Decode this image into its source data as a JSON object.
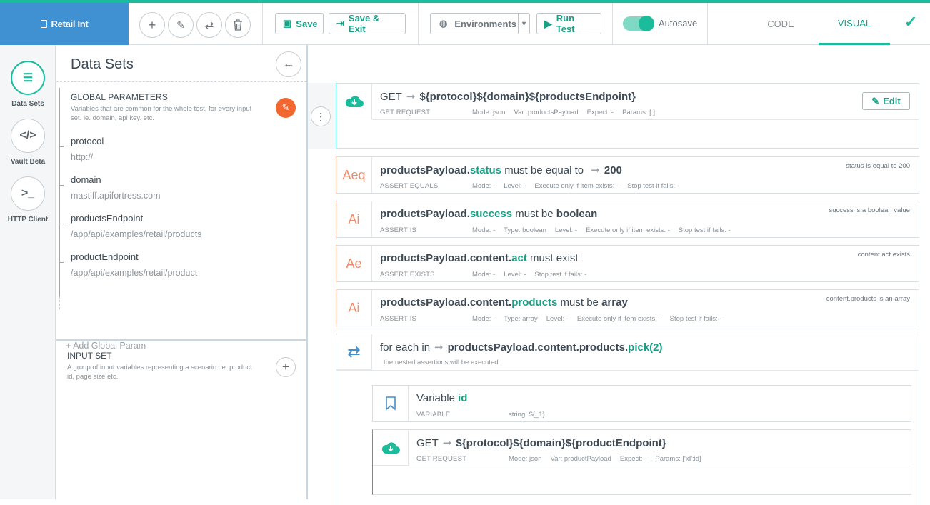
{
  "header": {
    "brand": "Retail Int",
    "save": "Save",
    "save_exit": "Save & Exit",
    "environments": "Environments",
    "run_test": "Run Test",
    "autosave": "Autosave",
    "tab_code": "CODE",
    "tab_visual": "VISUAL"
  },
  "leftnav": {
    "items": [
      {
        "label": "Data Sets",
        "icon": "list-icon"
      },
      {
        "label": "Vault Beta",
        "icon": "code-icon"
      },
      {
        "label": "HTTP Client",
        "icon": "terminal-icon"
      }
    ]
  },
  "panel": {
    "title": "Data Sets",
    "global_title": "GLOBAL PARAMETERS",
    "global_desc": "Variables that are common for the whole test, for every input set. ie. domain, api key. etc.",
    "params": [
      {
        "name": "protocol",
        "value": "http://"
      },
      {
        "name": "domain",
        "value": "mastiff.apifortress.com"
      },
      {
        "name": "productsEndpoint",
        "value": "/app/api/examples/retail/products"
      },
      {
        "name": "productEndpoint",
        "value": "/app/api/examples/retail/product"
      }
    ],
    "add_global": "+ Add Global Param",
    "input_title": "INPUT SET",
    "input_desc": "A group of input variables representing a scenario. ie. product id, page size etc."
  },
  "canvas": {
    "get1": {
      "method": "GET",
      "url": "${protocol}${domain}${productsEndpoint}",
      "label": "GET REQUEST",
      "mode": "Mode: json",
      "var": "Var: productsPayload",
      "expect": "Expect: -",
      "params": "Params: [:]",
      "edit": "Edit"
    },
    "assert1": {
      "icon": "Aeq",
      "obj": "productsPayload.",
      "field": "status",
      "text": " must be equal to ",
      "value": "200",
      "label": "ASSERT EQUALS",
      "meta": [
        "Mode: -",
        "Level: -",
        "Execute only if item exists: -",
        "Stop test if fails: -"
      ],
      "comment": "status is equal to 200"
    },
    "assert2": {
      "icon": "Ai",
      "obj": "productsPayload.",
      "field": "success",
      "text": " must be ",
      "value": "boolean",
      "label": "ASSERT IS",
      "meta": [
        "Mode: -",
        "Type: boolean",
        "Level: -",
        "Execute only if item exists: -",
        "Stop test if fails: -"
      ],
      "comment": "success is a boolean value"
    },
    "assert3": {
      "icon": "Ae",
      "obj": "productsPayload.content.",
      "field": "act",
      "text": " must exist",
      "label": "ASSERT EXISTS",
      "meta": [
        "Mode: -",
        "Level: -",
        "Stop test if fails: -"
      ],
      "comment": "content.act exists"
    },
    "assert4": {
      "icon": "Ai",
      "obj": "productsPayload.content.",
      "field": "products",
      "text": " must be ",
      "value": "array",
      "label": "ASSERT IS",
      "meta": [
        "Mode: -",
        "Type: array",
        "Level: -",
        "Execute only if item exists: -",
        "Stop test if fails: -"
      ],
      "comment": "content.products is an array"
    },
    "foreach": {
      "prefix": "for each in",
      "obj": "productsPayload.content.products.",
      "field": "pick(2)",
      "note": "the nested assertions will be executed"
    },
    "variable": {
      "prefix": "Variable ",
      "name": "id",
      "label": "VARIABLE",
      "meta": "string: ${_1}"
    },
    "get2": {
      "method": "GET",
      "url": "${protocol}${domain}${productEndpoint}",
      "label": "GET REQUEST",
      "mode": "Mode: json",
      "var": "Var: productPayload",
      "expect": "Expect: -",
      "params": "Params: ['id':id]"
    }
  },
  "colors": {
    "accent": "#1abc9c",
    "brand": "#3f91d1",
    "assert": "#ef8b6a",
    "orange": "#f2662f"
  }
}
